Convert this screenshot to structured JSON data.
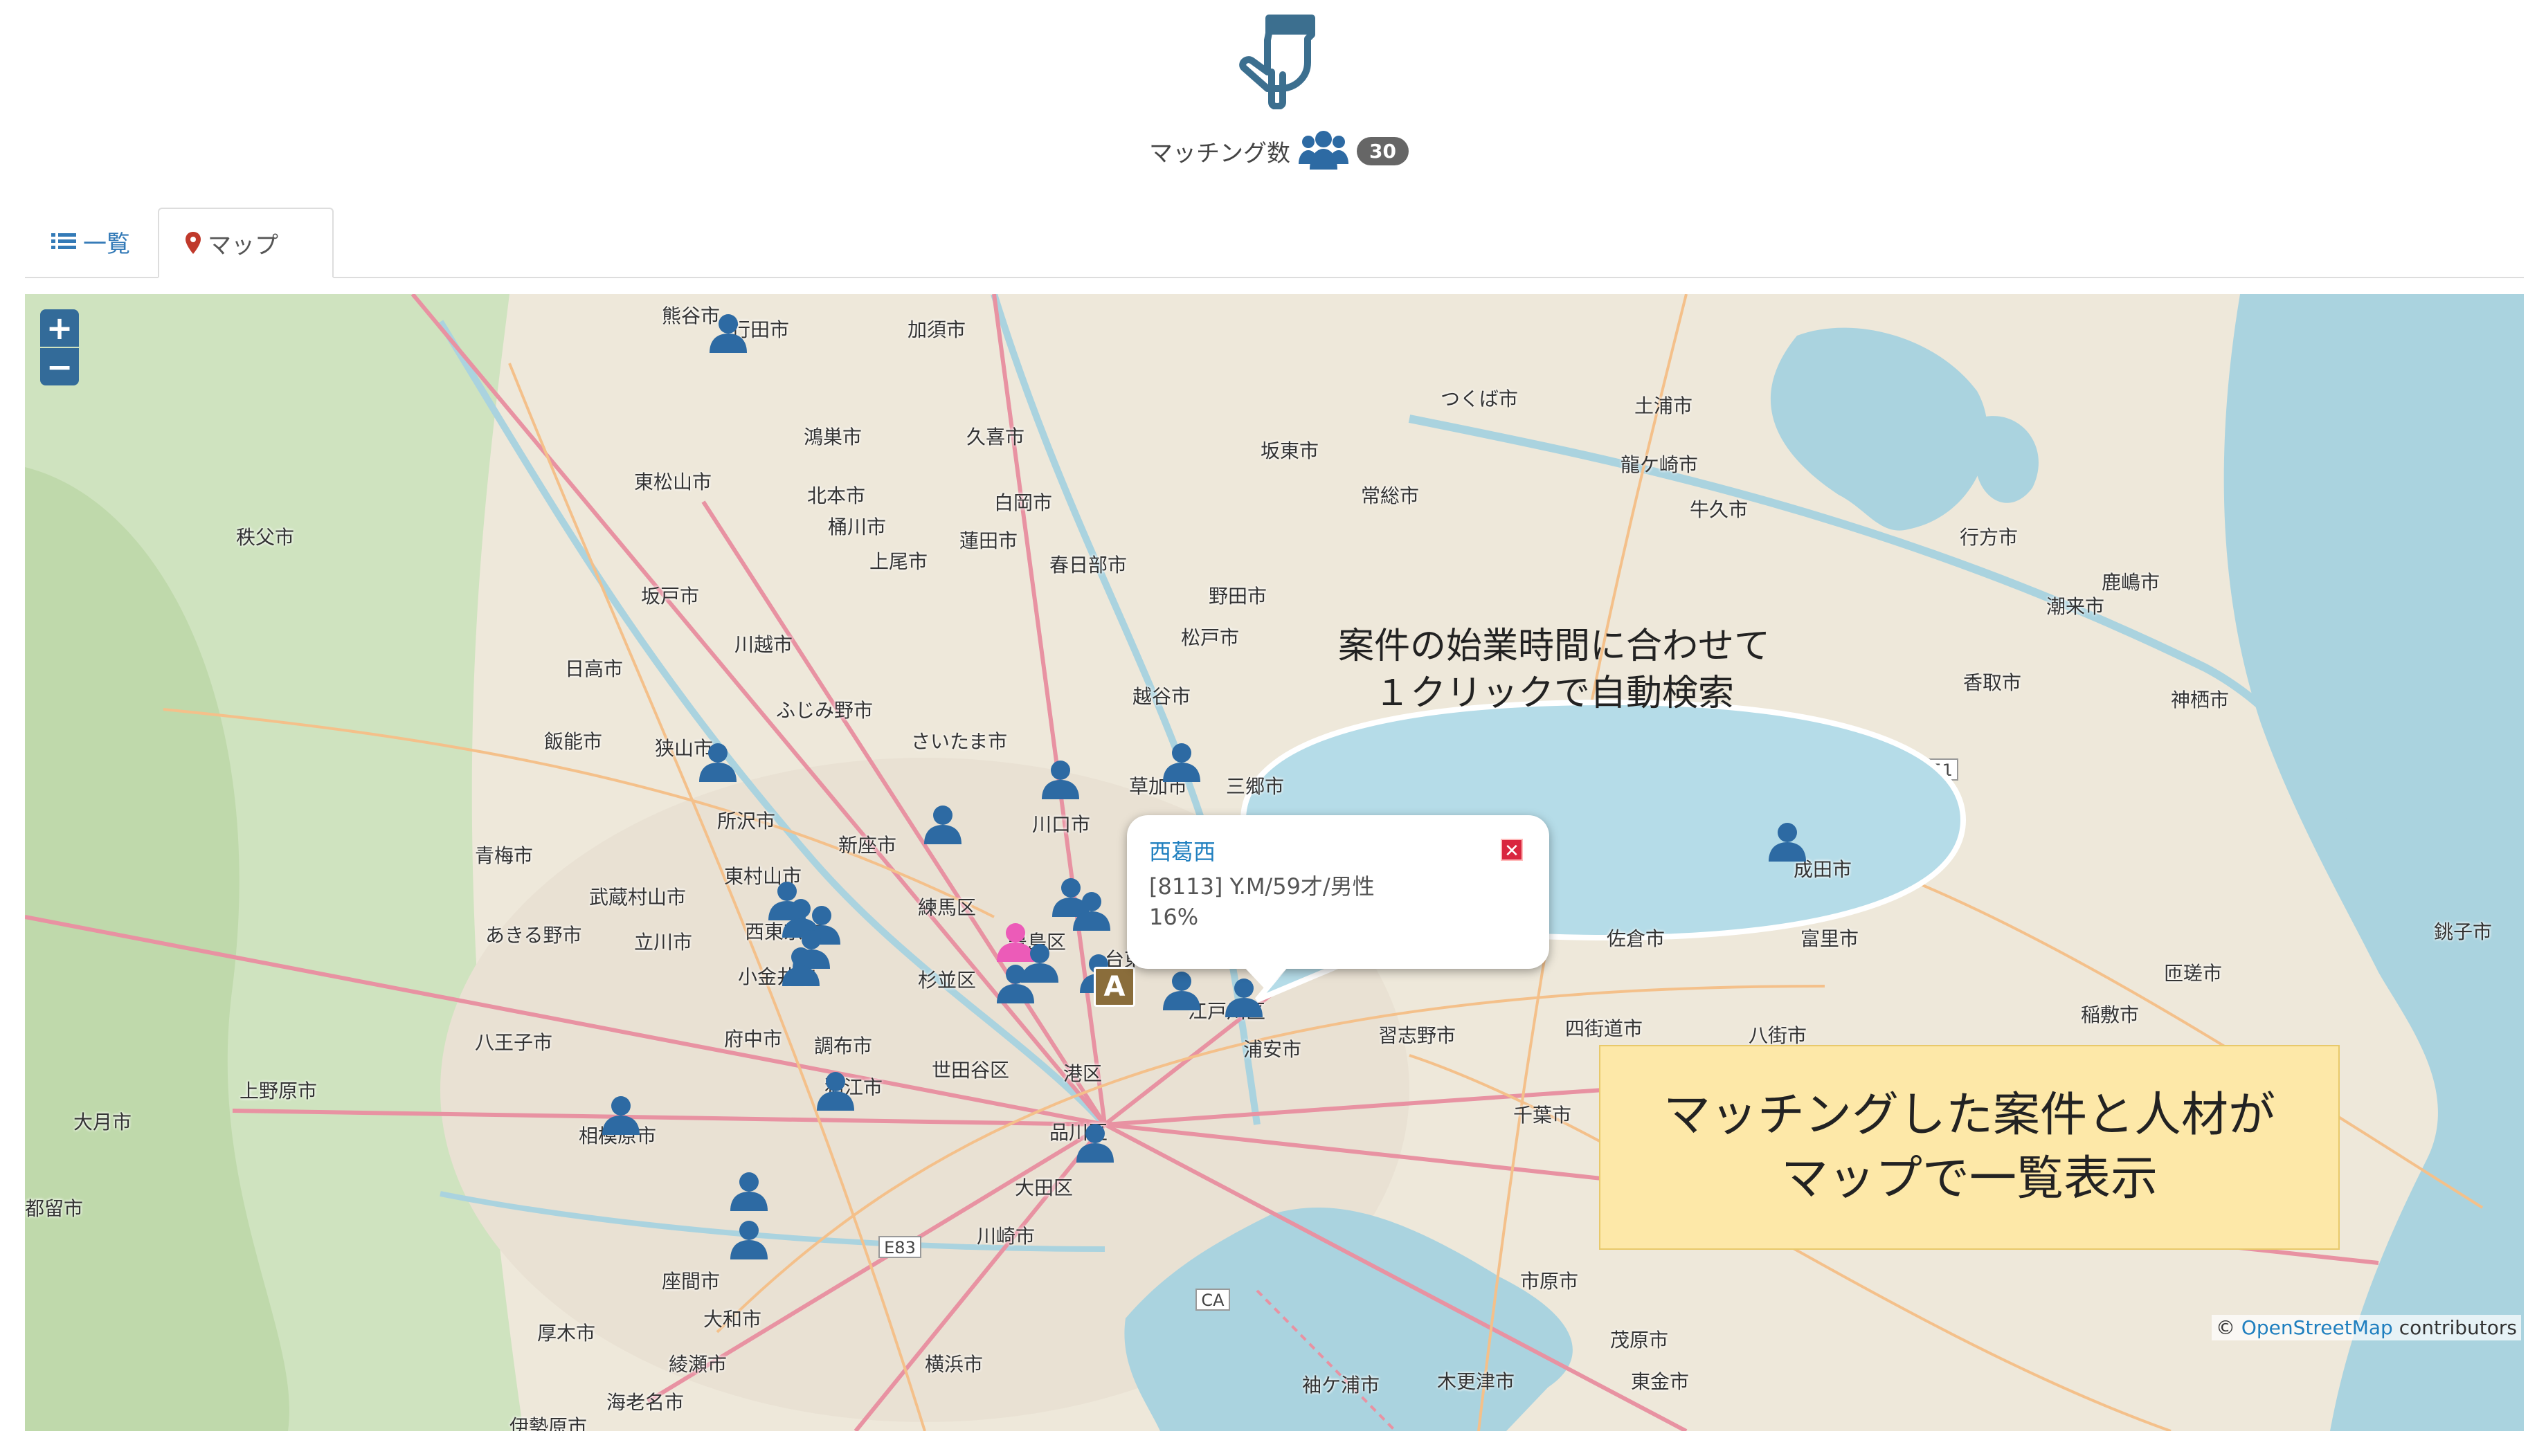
{
  "header": {
    "hand_icon": "pointing-hand-icon",
    "match_label": "マッチング数",
    "group_icon": "users-icon",
    "match_count": "30"
  },
  "tabs": [
    {
      "label": "一覧",
      "icon": "list-icon"
    },
    {
      "label": "マップ",
      "icon": "map-marker-icon"
    }
  ],
  "map": {
    "zoom_in": "+",
    "zoom_out": "−",
    "cities": [
      "熊谷市",
      "行田市",
      "加須市",
      "鴻巣市",
      "東松山市",
      "北本市",
      "久喜市",
      "桶川市",
      "白岡市",
      "上尾市",
      "蓮田市",
      "春日部市",
      "坂東市",
      "常総市",
      "つくば市",
      "土浦市",
      "秩父市",
      "坂戸市",
      "川越市",
      "ふじみ野市",
      "日高市",
      "さいたま市",
      "越谷市",
      "草加市",
      "三郷市",
      "川口市",
      "新座市",
      "飯能市",
      "狭山市",
      "所沢市",
      "青梅市",
      "東村山市",
      "武蔵村山市",
      "西東京市",
      "練馬区",
      "豊島区",
      "あきる野市",
      "立川市",
      "小金井市",
      "杉並区",
      "台東区",
      "江戸川区",
      "府中市",
      "調布市",
      "八王子市",
      "狛江市",
      "世田谷区",
      "港区",
      "上野原市",
      "大月市",
      "相模原市",
      "品川区",
      "大田区",
      "都留市",
      "川崎市",
      "座間市",
      "大和市",
      "厚木市",
      "綾瀬市",
      "横浜市",
      "海老名市",
      "伊勢原市",
      "浦安市",
      "習志野市",
      "四街道市",
      "佐倉市",
      "八街市",
      "富里市",
      "成田市",
      "千葉市",
      "市原市",
      "木更津市",
      "袖ケ浦市",
      "茂原市",
      "行方市",
      "鹿嶋市",
      "潮来市",
      "神栖市",
      "香取市",
      "銚子市",
      "匝瑳市",
      "野田市",
      "松戸市",
      "龍ケ崎市",
      "牛久市",
      "稲敷市",
      "東金市"
    ],
    "road_labels": [
      "E51",
      "E83",
      "CA"
    ],
    "station_badge": "A",
    "popup": {
      "title": "西葛西",
      "line1": "[8113] Y.M/59才/男性",
      "line2": "16%",
      "close_icon": "close-icon"
    },
    "attribution_prefix": "©",
    "attribution_link": "OpenStreetMap",
    "attribution_suffix": "contributors"
  },
  "callouts": {
    "bubble_line1": "案件の始業時間に合わせて",
    "bubble_line2": "１クリックで自動検索",
    "note_line1": "マッチングした案件と人材が",
    "note_line2": "マップで一覧表示"
  },
  "colors": {
    "accent": "#337ab7",
    "marker_blue": "#2d6aa3",
    "marker_pink": "#ec5bb8",
    "bubble": "#b5dce8",
    "note": "#fde8a8"
  }
}
